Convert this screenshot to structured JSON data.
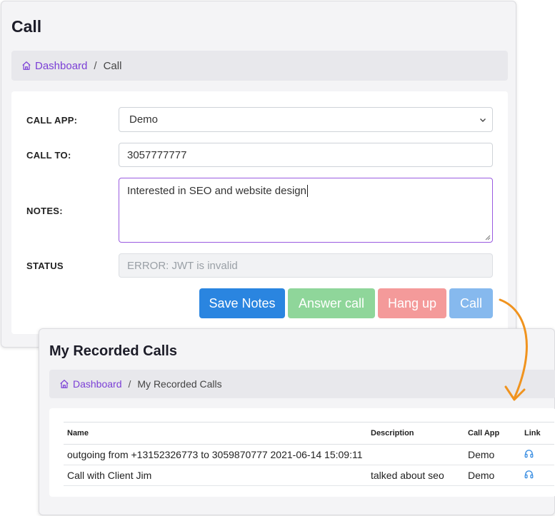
{
  "call_page": {
    "title": "Call",
    "breadcrumb": {
      "home": "Dashboard",
      "separator": "/",
      "current": "Call"
    },
    "form": {
      "call_app": {
        "label": "CALL APP:",
        "selected": "Demo"
      },
      "call_to": {
        "label": "CALL TO:",
        "value": "3057777777"
      },
      "notes": {
        "label": "NOTES:",
        "value": "Interested in SEO and website design"
      },
      "status": {
        "label": "STATUS",
        "placeholder": "ERROR: JWT is invalid"
      }
    },
    "buttons": {
      "save_notes": "Save Notes",
      "answer_call": "Answer call",
      "hang_up": "Hang up",
      "call": "Call"
    }
  },
  "recorded_calls": {
    "title": "My Recorded Calls",
    "breadcrumb": {
      "home": "Dashboard",
      "separator": "/",
      "current": "My Recorded Calls"
    },
    "table": {
      "headers": [
        "Name",
        "Description",
        "Call App",
        "Link"
      ],
      "rows": [
        {
          "name": "outgoing from +13152326773 to 3059870777 2021-06-14 15:09:11",
          "description": "",
          "call_app": "Demo",
          "link_icon": "headset-icon"
        },
        {
          "name": "Call with Client Jim",
          "description": "talked about seo",
          "call_app": "Demo",
          "link_icon": "headset-icon"
        }
      ]
    }
  },
  "colors": {
    "accent": "#7b3fd6",
    "save_button": "#2a85e0",
    "answer_button": "#8fd69a",
    "hangup_button": "#f49a9a",
    "call_button": "#86b9ee",
    "arrow": "#f0931e",
    "link_icon": "#2a85e0"
  }
}
